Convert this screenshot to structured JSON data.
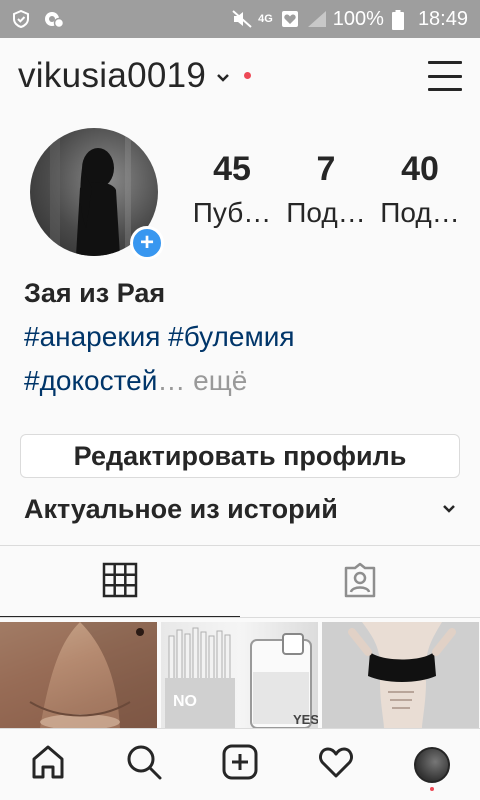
{
  "status_bar": {
    "battery": "100%",
    "time": "18:49",
    "network": "4G"
  },
  "header": {
    "username": "vikusia0019"
  },
  "profile": {
    "stats": [
      {
        "value": "45",
        "label": "Пуб…"
      },
      {
        "value": "7",
        "label": "Под…"
      },
      {
        "value": "40",
        "label": "Под…"
      }
    ],
    "name": "Зая из Рая",
    "bio_line1": "#анарекия #булемия",
    "bio_line2": "#докостей",
    "bio_more": "… ещё",
    "edit_button": "Редактировать профиль",
    "highlights_title": "Актуальное из историй"
  },
  "grid_overlay_text": {
    "cell2_left": "NO",
    "cell2_right": "YES"
  },
  "colors": {
    "accent": "#3897f0",
    "notification": "#ed4956",
    "hashtag": "#003569",
    "status_bar": "#9e9e9e"
  }
}
